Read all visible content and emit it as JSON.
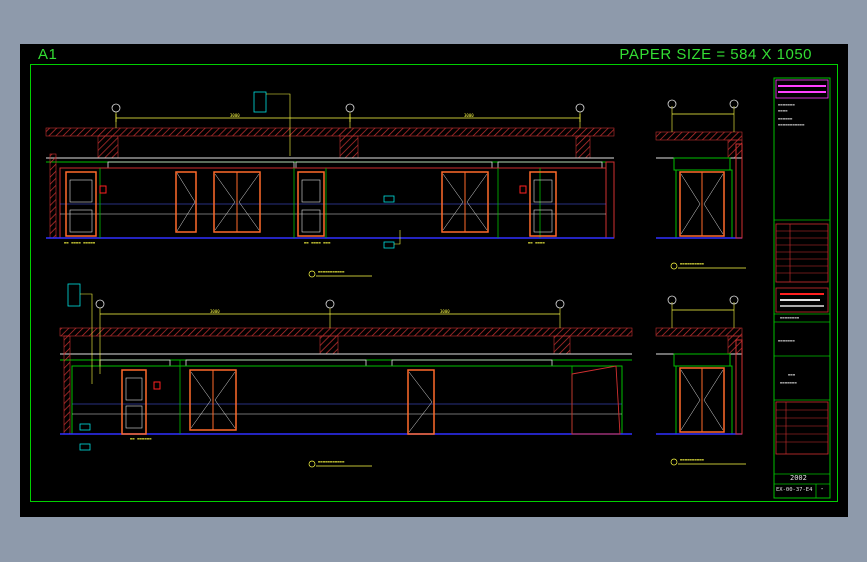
{
  "sheet": {
    "name": "A1",
    "paper_size": "PAPER SIZE = 584 X 1050"
  },
  "title_block": {
    "drawing_date": "2002",
    "drawing_number": "EX-00-37-E4",
    "sheet_mark": "-"
  },
  "colors": {
    "background": "#000000",
    "frame": "#00d000",
    "header_text": "#33dd33",
    "hatch": "#c03030",
    "wall": "#d03030",
    "door": "#ff6a2a",
    "dimension": "#ffff44",
    "floor": "#3030ff",
    "ceiling": "#e0e0e0",
    "grid": "#5060ff",
    "annotation": "#00e0e0",
    "green_line": "#00c000",
    "magenta": "#ff40ff"
  },
  "icons": [
    "grid-bubble-icon",
    "section-mark-icon",
    "door-icon"
  ]
}
